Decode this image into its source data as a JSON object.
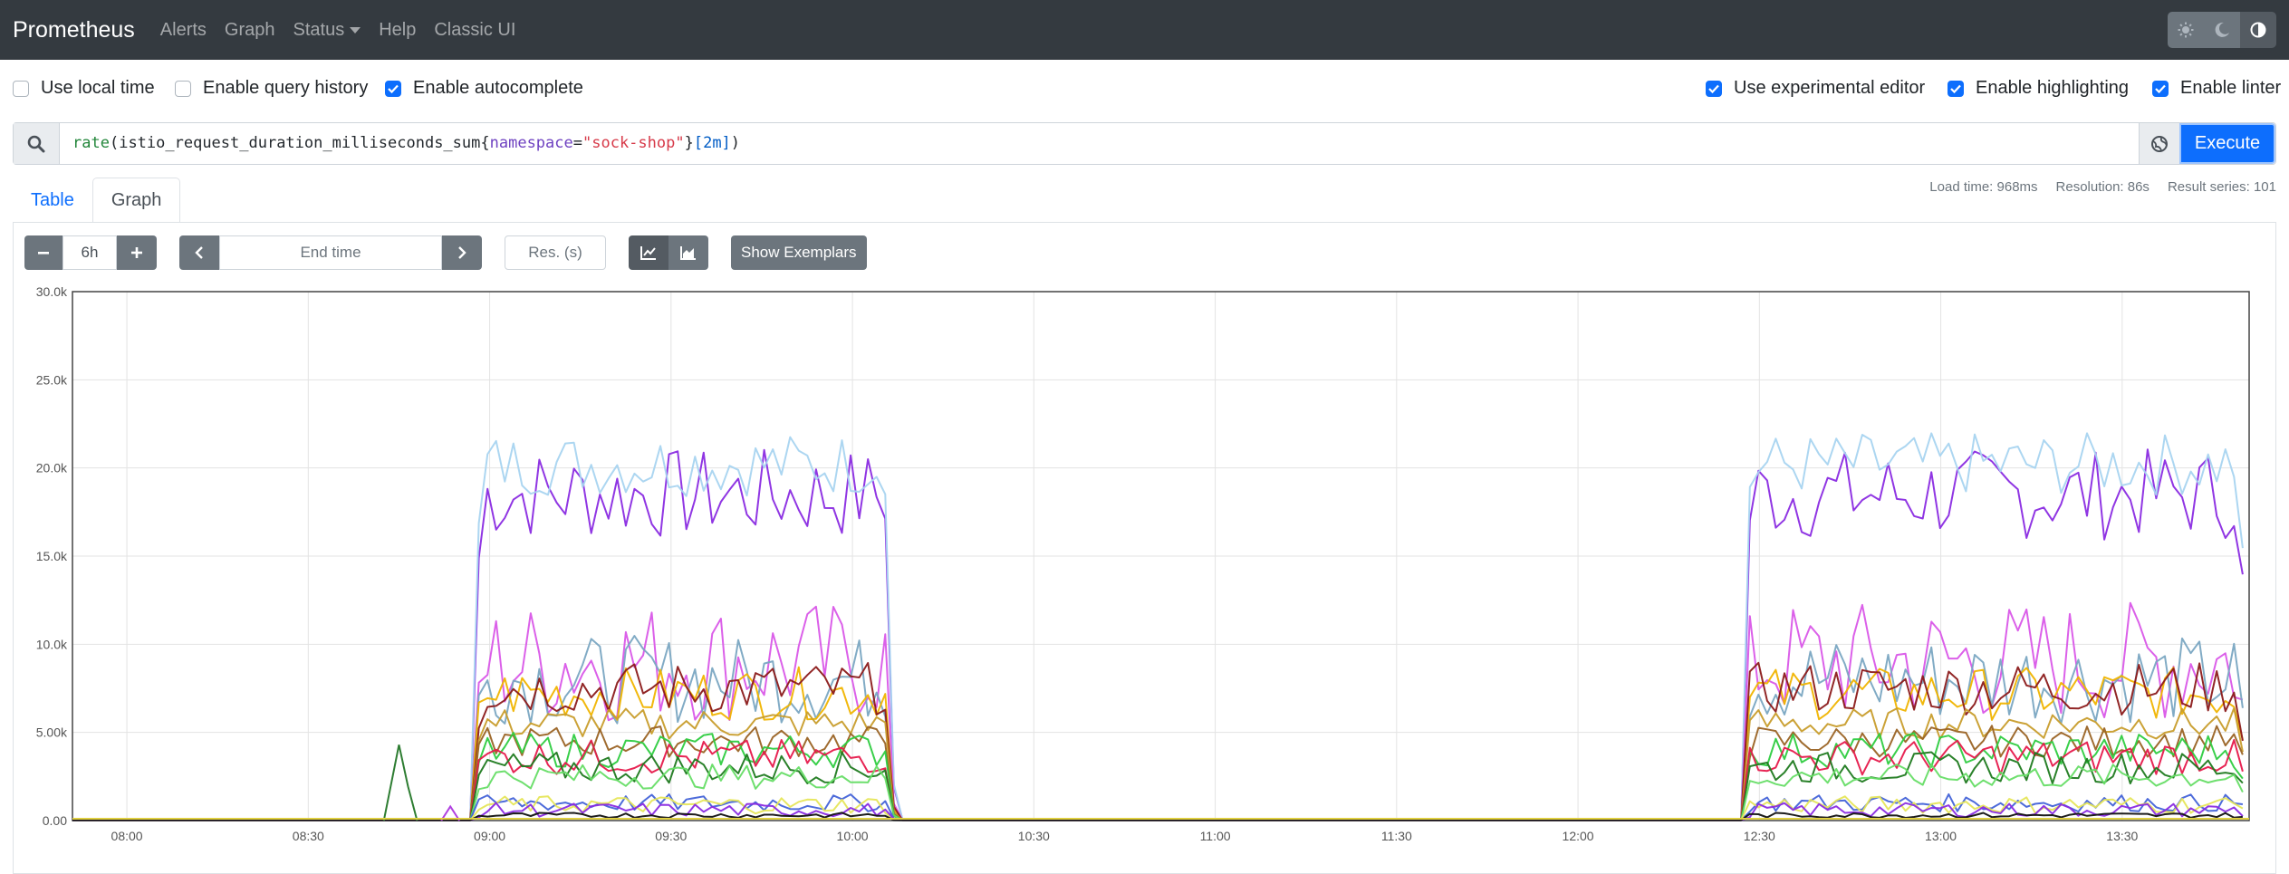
{
  "navbar": {
    "brand": "Prometheus",
    "links": [
      "Alerts",
      "Graph",
      "Status",
      "Help",
      "Classic UI"
    ],
    "theme_icons": [
      "sun-icon",
      "moon-icon",
      "contrast-icon"
    ]
  },
  "options": {
    "use_local_time": {
      "label": "Use local time",
      "checked": false
    },
    "enable_query_history": {
      "label": "Enable query history",
      "checked": false
    },
    "enable_autocomplete": {
      "label": "Enable autocomplete",
      "checked": true
    },
    "use_experimental_editor": {
      "label": "Use experimental editor",
      "checked": true
    },
    "enable_highlighting": {
      "label": "Enable highlighting",
      "checked": true
    },
    "enable_linter": {
      "label": "Enable linter",
      "checked": true
    }
  },
  "query": {
    "fn": "rate",
    "metric": "istio_request_duration_milliseconds_sum",
    "label_name": "namespace",
    "label_value": "\"sock-shop\"",
    "range": "[2m]",
    "execute_label": "Execute"
  },
  "tabs": [
    {
      "label": "Table",
      "active": false
    },
    {
      "label": "Graph",
      "active": true
    }
  ],
  "stats": {
    "load_time": "Load time: 968ms",
    "resolution": "Resolution: 86s",
    "result_series": "Result series: 101"
  },
  "controls": {
    "range": "6h",
    "end_time_placeholder": "End time",
    "res_placeholder": "Res. (s)",
    "show_exemplars": "Show Exemplars"
  },
  "chart_data": {
    "type": "line",
    "y_ticks": [
      "0.00",
      "5.00k",
      "10.0k",
      "15.0k",
      "20.0k",
      "25.0k",
      "30.0k"
    ],
    "x_ticks": [
      "08:00",
      "08:30",
      "09:00",
      "09:30",
      "10:00",
      "10:30",
      "11:00",
      "11:30",
      "12:00",
      "12:30",
      "13:00",
      "13:30"
    ],
    "ylim": [
      0,
      30000
    ],
    "x_range_minutes": [
      471,
      831
    ],
    "grid": true,
    "active_windows_minutes": [
      [
        537,
        607
      ],
      [
        747,
        831
      ]
    ],
    "series_levels": [
      {
        "color": "#8a2be2",
        "mean": 18500,
        "amp": 2600
      },
      {
        "color": "#a8d4f0",
        "mean": 20200,
        "amp": 1800
      },
      {
        "color": "#d957e8",
        "mean": 9000,
        "amp": 3500
      },
      {
        "color": "#7aa6c2",
        "mean": 8000,
        "amp": 2500
      },
      {
        "color": "#f0b400",
        "mean": 7200,
        "amp": 1500
      },
      {
        "color": "#8b1a1a",
        "mean": 7500,
        "amp": 1500
      },
      {
        "color": "#c89d2c",
        "mean": 5500,
        "amp": 900
      },
      {
        "color": "#9a6324",
        "mean": 4500,
        "amp": 900
      },
      {
        "color": "#2ecc40",
        "mean": 4000,
        "amp": 1000
      },
      {
        "color": "#e6194b",
        "mean": 3600,
        "amp": 1000
      },
      {
        "color": "#1f7a1f",
        "mean": 3000,
        "amp": 900
      },
      {
        "color": "#66dd66",
        "mean": 2500,
        "amp": 700
      },
      {
        "color": "#4363d8",
        "mean": 1000,
        "amp": 500
      },
      {
        "color": "#e6e65a",
        "mean": 900,
        "amp": 500
      },
      {
        "color": "#8a2be2",
        "mean": 600,
        "amp": 400
      },
      {
        "color": "#111111",
        "mean": 300,
        "amp": 150
      }
    ],
    "spike": {
      "color": "#2e7d32",
      "minute": 525,
      "value": 4300
    }
  }
}
